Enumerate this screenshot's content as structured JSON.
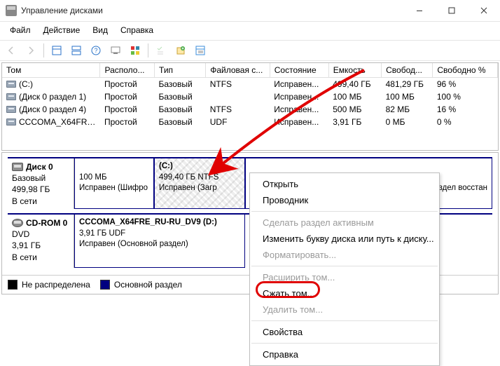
{
  "window": {
    "title": "Управление дисками"
  },
  "menu": {
    "file": "Файл",
    "action": "Действие",
    "view": "Вид",
    "help": "Справка"
  },
  "columns": {
    "volume": "Том",
    "layout": "Располо...",
    "type": "Тип",
    "fs": "Файловая с...",
    "state": "Состояние",
    "capacity": "Емкость",
    "free": "Свобод...",
    "freepct": "Свободно %"
  },
  "rows": [
    {
      "name": "(C:)",
      "layout": "Простой",
      "type": "Базовый",
      "fs": "NTFS",
      "state": "Исправен...",
      "cap": "499,40 ГБ",
      "free": "481,29 ГБ",
      "pct": "96 %"
    },
    {
      "name": "(Диск 0 раздел 1)",
      "layout": "Простой",
      "type": "Базовый",
      "fs": "",
      "state": "Исправен...",
      "cap": "100 МБ",
      "free": "100 МБ",
      "pct": "100 %"
    },
    {
      "name": "(Диск 0 раздел 4)",
      "layout": "Простой",
      "type": "Базовый",
      "fs": "NTFS",
      "state": "Исправен...",
      "cap": "500 МБ",
      "free": "82 МБ",
      "pct": "16 %"
    },
    {
      "name": "CCCOMA_X64FRE...",
      "layout": "Простой",
      "type": "Базовый",
      "fs": "UDF",
      "state": "Исправен...",
      "cap": "3,91 ГБ",
      "free": "0 МБ",
      "pct": "0 %"
    }
  ],
  "disk0": {
    "name": "Диск 0",
    "type": "Базовый",
    "size": "499,98 ГБ",
    "status": "В сети",
    "p1": {
      "size": "100 МБ",
      "state": "Исправен (Шифро"
    },
    "p2": {
      "name": "(C:)",
      "line2": "499,40 ГБ NTFS",
      "state": "Исправен (Загр"
    },
    "p3": {
      "state_l1": "раздел восстан"
    }
  },
  "cdrom": {
    "name": "CD-ROM 0",
    "type": "DVD",
    "size": "3,91 ГБ",
    "status": "В сети",
    "vol": {
      "name": "CCCOMA_X64FRE_RU-RU_DV9  (D:)",
      "line2": "3,91 ГБ UDF",
      "state": "Исправен (Основной раздел)"
    }
  },
  "legend": {
    "unallocated": "Не распределена",
    "primary": "Основной раздел"
  },
  "menuItems": {
    "open": "Открыть",
    "explorer": "Проводник",
    "makeActive": "Сделать раздел активным",
    "changeLetter": "Изменить букву диска или путь к диску...",
    "format": "Форматировать...",
    "extend": "Расширить том...",
    "shrink": "Сжать том...",
    "delete": "Удалить том...",
    "properties": "Свойства",
    "help": "Справка"
  }
}
